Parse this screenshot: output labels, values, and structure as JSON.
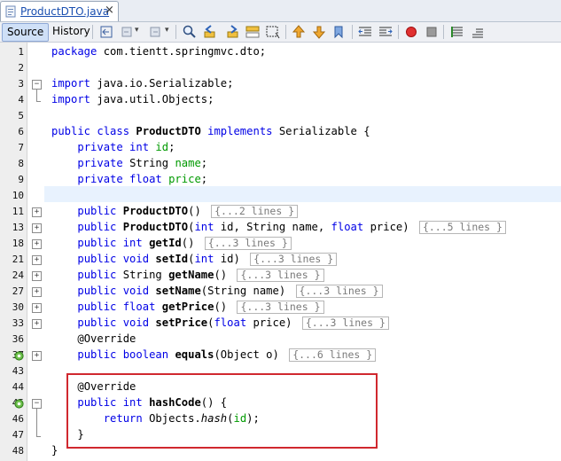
{
  "tab": {
    "filename": "ProductDTO.java",
    "close": "×"
  },
  "toolbar": {
    "source_label": "Source",
    "history_label": "History"
  },
  "editor": {
    "lines": [
      {
        "n": "1",
        "html": "<span class=\"kw\">package</span> com.tientt.springmvc.dto;"
      },
      {
        "n": "2",
        "html": ""
      },
      {
        "n": "3",
        "html": "<span class=\"kw\">import</span> java.io.Serializable;",
        "fold": "open"
      },
      {
        "n": "4",
        "html": "<span class=\"kw\">import</span> java.util.Objects;"
      },
      {
        "n": "5",
        "html": ""
      },
      {
        "n": "6",
        "html": "<span class=\"kw\">public class</span> <span class=\"bold\">ProductDTO</span> <span class=\"kw\">implements</span> Serializable {"
      },
      {
        "n": "7",
        "html": "    <span class=\"kw\">private int</span> <span class=\"fld\">id</span>;"
      },
      {
        "n": "8",
        "html": "    <span class=\"kw\">private</span> String <span class=\"fld\">name</span>;"
      },
      {
        "n": "9",
        "html": "    <span class=\"kw\">private float</span> <span class=\"fld\">price</span>;"
      },
      {
        "n": "10",
        "html": ""
      },
      {
        "n": "11",
        "html": "    <span class=\"kw\">public</span> <span class=\"bold\">ProductDTO</span>() <span class=\"fold\">{...2 lines }</span>",
        "fold": "collapsed"
      },
      {
        "n": "13",
        "html": "    <span class=\"kw\">public</span> <span class=\"bold\">ProductDTO</span>(<span class=\"kw\">int</span> id, String name, <span class=\"kw\">float</span> price) <span class=\"fold\">{...5 lines }</span>",
        "fold": "collapsed"
      },
      {
        "n": "18",
        "html": "    <span class=\"kw\">public int</span> <span class=\"bold\">getId</span>() <span class=\"fold\">{...3 lines }</span>",
        "fold": "collapsed"
      },
      {
        "n": "21",
        "html": "    <span class=\"kw\">public void</span> <span class=\"bold\">setId</span>(<span class=\"kw\">int</span> id) <span class=\"fold\">{...3 lines }</span>",
        "fold": "collapsed"
      },
      {
        "n": "24",
        "html": "    <span class=\"kw\">public</span> String <span class=\"bold\">getName</span>() <span class=\"fold\">{...3 lines }</span>",
        "fold": "collapsed"
      },
      {
        "n": "27",
        "html": "    <span class=\"kw\">public void</span> <span class=\"bold\">setName</span>(String name) <span class=\"fold\">{...3 lines }</span>",
        "fold": "collapsed"
      },
      {
        "n": "30",
        "html": "    <span class=\"kw\">public float</span> <span class=\"bold\">getPrice</span>() <span class=\"fold\">{...3 lines }</span>",
        "fold": "collapsed"
      },
      {
        "n": "33",
        "html": "    <span class=\"kw\">public void</span> <span class=\"bold\">setPrice</span>(<span class=\"kw\">float</span> price) <span class=\"fold\">{...3 lines }</span>",
        "fold": "collapsed"
      },
      {
        "n": "36",
        "html": "    <span class=\"ann\">@Override</span>"
      },
      {
        "n": "37",
        "html": "    <span class=\"kw\">public boolean</span> <span class=\"bold\">equals</span>(Object o) <span class=\"fold\">{...6 lines }</span>",
        "fold": "collapsed",
        "override": true
      },
      {
        "n": "43",
        "html": ""
      },
      {
        "n": "44",
        "html": "    <span class=\"ann\">@Override</span>"
      },
      {
        "n": "45",
        "html": "    <span class=\"kw\">public int</span> <span class=\"bold\">hashCode</span>() {",
        "fold": "open",
        "override": true
      },
      {
        "n": "46",
        "html": "        <span class=\"kw\">return</span> Objects.<span class=\"ital\">hash</span>(<span class=\"fld\">id</span>);"
      },
      {
        "n": "47",
        "html": "    }",
        "foldend": true
      },
      {
        "n": "48",
        "html": "}"
      }
    ]
  },
  "colors": {
    "highlight_border": "#d0282f",
    "keyword": "#0000e6",
    "field": "#009a00"
  }
}
